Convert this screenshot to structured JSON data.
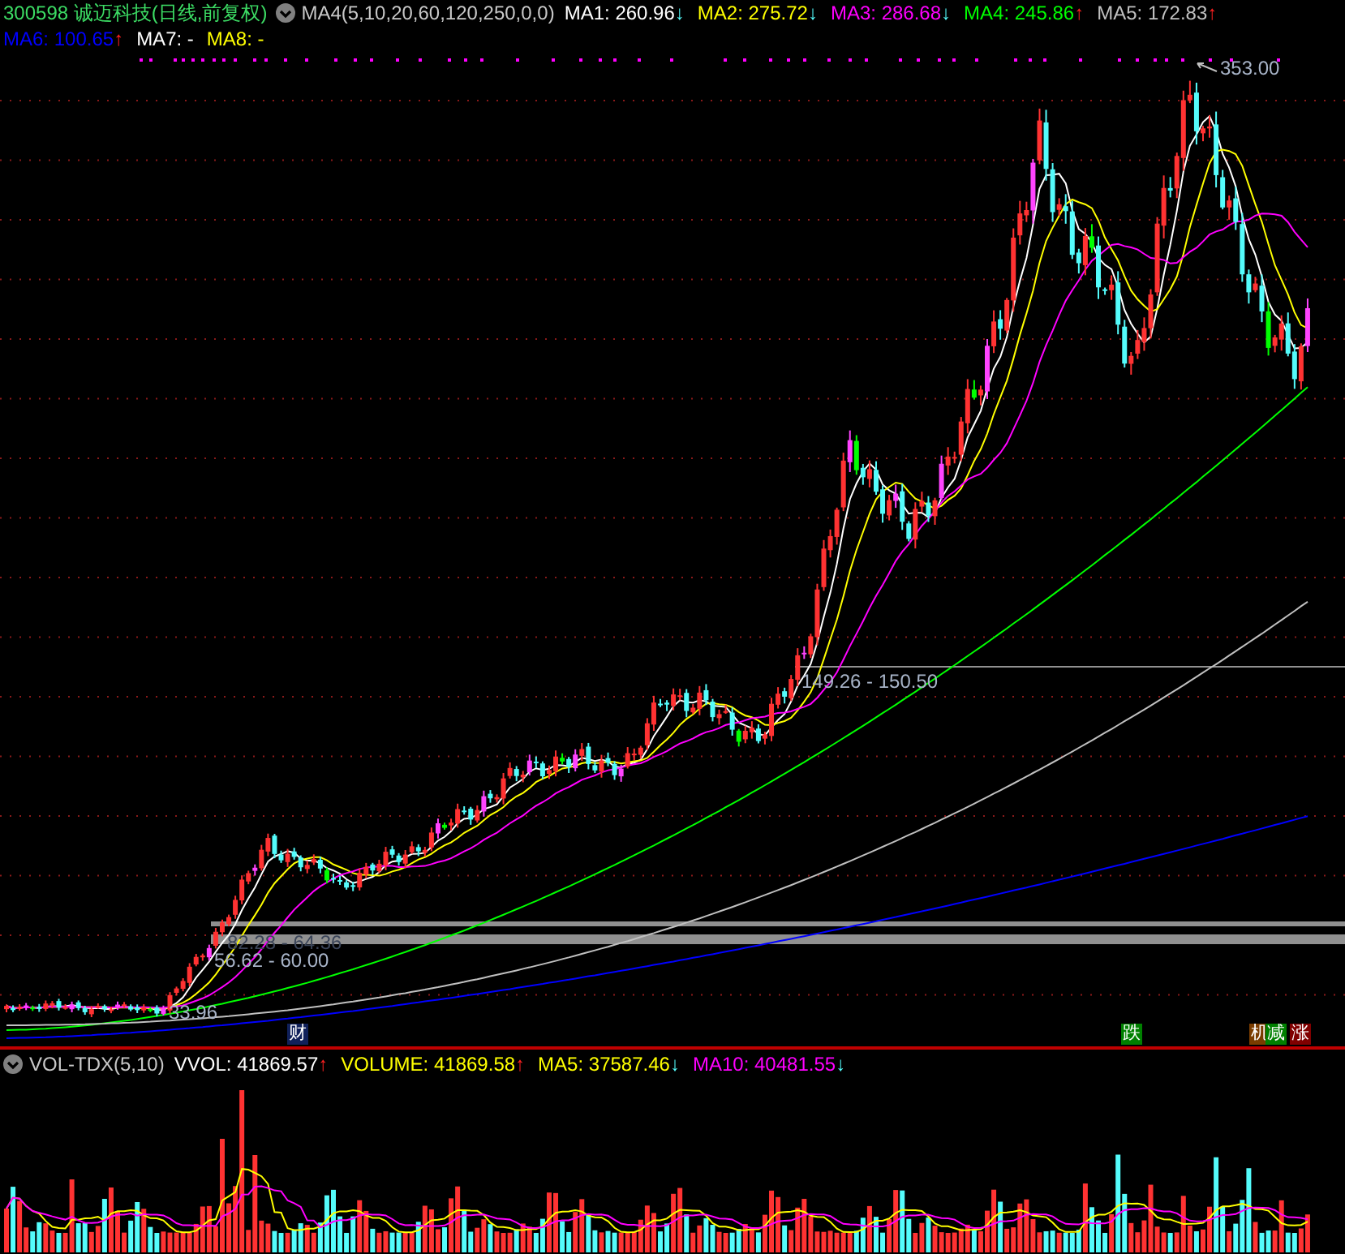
{
  "main_panel": {
    "title": "300598 诚迈科技(日线,前复权)",
    "indicator": "MA4(5,10,20,60,120,250,0,0)",
    "ma_values": [
      {
        "label": "MA1:",
        "value": "260.96",
        "arrow": "↓",
        "rising": false,
        "color": "#ffffff"
      },
      {
        "label": "MA2:",
        "value": "275.72",
        "arrow": "↓",
        "rising": false,
        "color": "#ffff00"
      },
      {
        "label": "MA3:",
        "value": "286.68",
        "arrow": "↓",
        "rising": false,
        "color": "#ff00ff"
      },
      {
        "label": "MA4:",
        "value": "245.86",
        "arrow": "↑",
        "rising": true,
        "color": "#00ff00"
      },
      {
        "label": "MA5:",
        "value": "172.83",
        "arrow": "↑",
        "rising": true,
        "color": "#c0c0c0"
      },
      {
        "label": "MA6:",
        "value": "100.65",
        "arrow": "↑",
        "rising": true,
        "color": "#0000ff"
      },
      {
        "label": "MA7:",
        "value": "-",
        "color": "#ffffff"
      },
      {
        "label": "MA8:",
        "value": "-",
        "color": "#ffff00"
      }
    ],
    "annotations": [
      "353.00",
      "149.26 - 150.50",
      "82.28 - 64.36",
      "56.62 - 60.00",
      "33.96"
    ],
    "event_markers": [
      {
        "text": "财",
        "color": "#10205a"
      },
      {
        "text": "跌",
        "color": "#008000"
      },
      {
        "text": "机",
        "color": "#7a3c00"
      },
      {
        "text": "减",
        "color": "#008000"
      },
      {
        "text": "涨",
        "color": "#800000"
      }
    ]
  },
  "volume_panel": {
    "indicator": "VOL-TDX(5,10)",
    "values": [
      {
        "label": "VVOL:",
        "value": "41869.57",
        "arrow": "↑",
        "rising": true,
        "color": "#ffffff"
      },
      {
        "label": "VOLUME:",
        "value": "41869.58",
        "arrow": "↑",
        "rising": true,
        "color": "#ffff00"
      },
      {
        "label": "MA5:",
        "value": "37587.46",
        "arrow": "↓",
        "rising": false,
        "color": "#ffff00"
      },
      {
        "label": "MA10:",
        "value": "40481.55",
        "arrow": "↓",
        "rising": false,
        "color": "#ff00ff"
      }
    ]
  }
}
